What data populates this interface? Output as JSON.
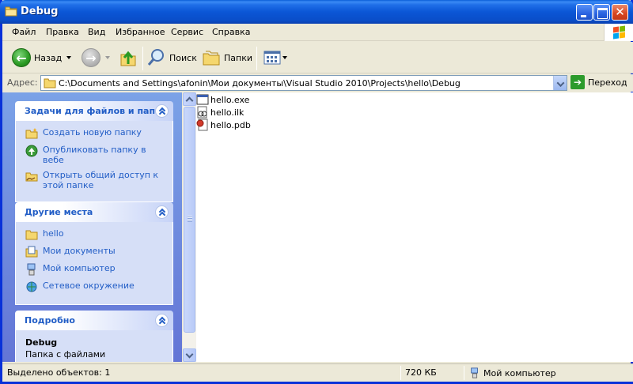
{
  "window": {
    "title": "Debug"
  },
  "menu": {
    "items": [
      "Файл",
      "Правка",
      "Вид",
      "Избранное",
      "Сервис",
      "Справка"
    ]
  },
  "toolbar": {
    "back_label": "Назад",
    "search_label": "Поиск",
    "folders_label": "Папки"
  },
  "address": {
    "label": "Адрес:",
    "path": "C:\\Documents and Settings\\afonin\\Мои документы\\Visual Studio 2010\\Projects\\hello\\Debug",
    "go_label": "Переход"
  },
  "taskpane": {
    "file_tasks": {
      "title": "Задачи для файлов и папок",
      "items": [
        {
          "label": "Создать новую папку",
          "icon": "new-folder-icon"
        },
        {
          "label": "Опубликовать папку в вебе",
          "icon": "publish-web-icon"
        },
        {
          "label": "Открыть общий доступ к этой папке",
          "icon": "share-folder-icon"
        }
      ]
    },
    "other_places": {
      "title": "Другие места",
      "items": [
        {
          "label": "hello",
          "icon": "folder-icon"
        },
        {
          "label": "Мои документы",
          "icon": "my-documents-icon"
        },
        {
          "label": "Мой компьютер",
          "icon": "my-computer-icon"
        },
        {
          "label": "Сетевое окружение",
          "icon": "network-icon"
        }
      ]
    },
    "details": {
      "title": "Подробно",
      "name": "Debug",
      "type": "Папка с файлами"
    }
  },
  "files": [
    {
      "name": "hello.exe",
      "icon": "exe-file-icon"
    },
    {
      "name": "hello.ilk",
      "icon": "ilk-file-icon"
    },
    {
      "name": "hello.pdb",
      "icon": "pdb-file-icon"
    }
  ],
  "status": {
    "selected": "Выделено объектов: 1",
    "size": "720 КБ",
    "location": "Мой компьютер"
  },
  "colors": {
    "titlebar": "#0b56d6",
    "taskpane": "#6f8fe0",
    "link": "#215dc6"
  }
}
